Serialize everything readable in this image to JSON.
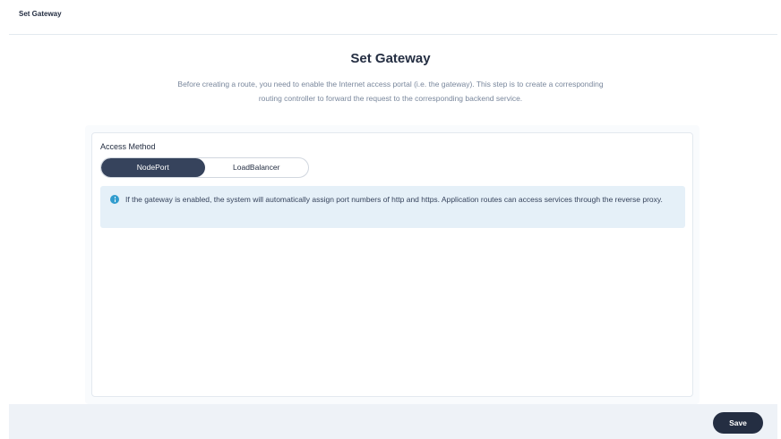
{
  "header": {
    "title": "Set Gateway"
  },
  "main": {
    "title": "Set Gateway",
    "description": "Before creating a route, you need to enable the Internet access portal (i.e. the gateway). This step is to create a corresponding routing controller to forward the request to the corresponding backend service."
  },
  "form": {
    "access_method_label": "Access Method",
    "options": [
      "NodePort",
      "LoadBalancer"
    ],
    "selected": "NodePort",
    "info_icon": "info-circle-icon",
    "info_text": "If the gateway is enabled, the system will automatically assign port numbers of http and https. Application routes can access services through the reverse proxy."
  },
  "footer": {
    "save_label": "Save"
  },
  "colors": {
    "primary": "#242e42",
    "selected_segment": "#36435c",
    "info_background": "#e5f0f8",
    "info_icon": "#329dce",
    "footer_background": "#eef2f7"
  }
}
